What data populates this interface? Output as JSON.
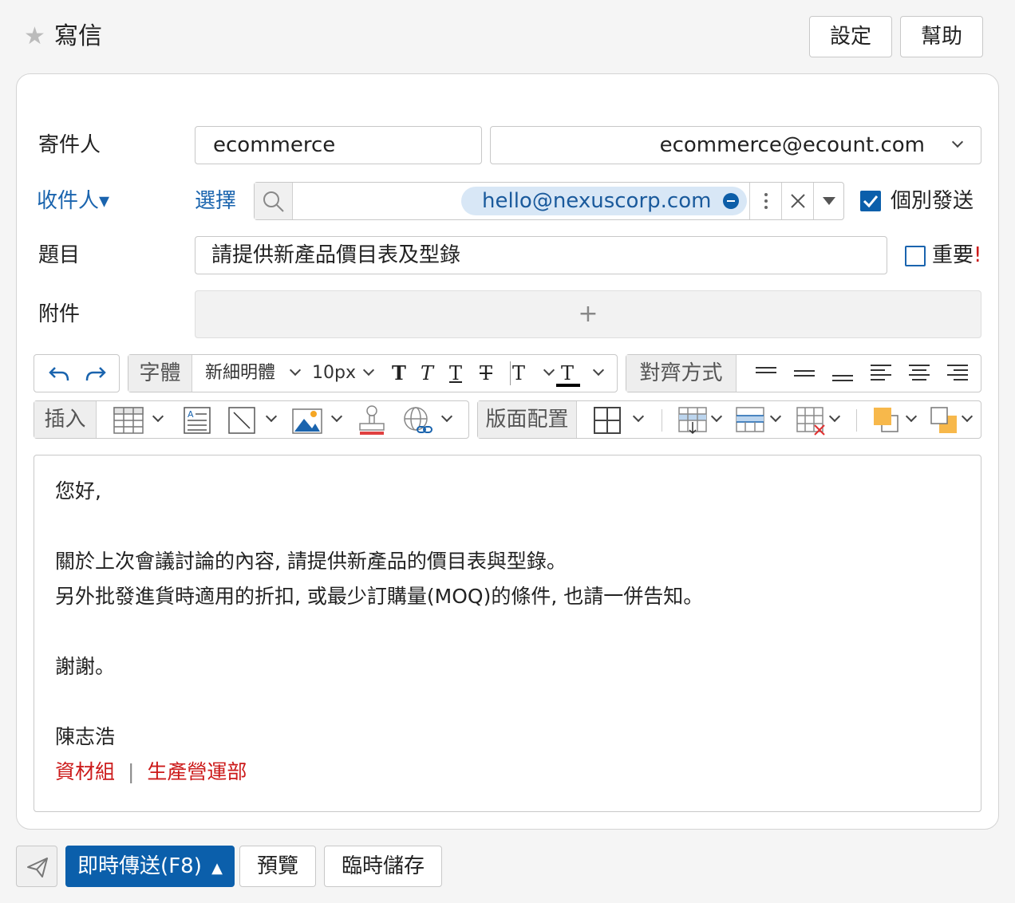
{
  "header": {
    "title": "寫信",
    "settings_label": "設定",
    "help_label": "幫助"
  },
  "form": {
    "sender_label": "寄件人",
    "sender_name": "ecommerce",
    "sender_email": "ecommerce@ecount.com",
    "recipient_label": "收件人",
    "recipient_caret": "▾",
    "select_link": "選擇",
    "recipient_chip": "hello@nexuscorp.com",
    "individual_send_label": "個別發送",
    "individual_send_checked": true,
    "subject_label": "題目",
    "subject_value": "請提供新產品價目表及型錄",
    "important_label": "重要",
    "important_mark": "!",
    "important_checked": false,
    "attachment_label": "附件",
    "attachment_add": "+"
  },
  "toolbar": {
    "font_group_label": "字體",
    "font_family": "新細明體",
    "font_size": "10px",
    "align_group_label": "對齊方式",
    "insert_group_label": "插入",
    "layout_group_label": "版面配置"
  },
  "body": {
    "lines": [
      "您好,",
      "關於上次會議討論的內容, 請提供新產品的價目表與型錄。",
      "另外批發進貨時適用的折扣, 或最少訂購量(MOQ)的條件, 也請一併告知。",
      "謝謝。",
      "陳志浩"
    ],
    "signature_dept": "資材組",
    "signature_separator": "|",
    "signature_division": "生產營運部"
  },
  "footer": {
    "send_label": "即時傳送(F8)",
    "send_caret": "▲",
    "preview_label": "預覽",
    "draft_label": "臨時儲存"
  },
  "colors": {
    "accent": "#0b5fab",
    "link": "#1a64ae",
    "chip_bg": "#d8e7f6",
    "signature_red": "#cc1a1a",
    "star": "#bbbbbb"
  },
  "icons": {
    "star": "star-icon",
    "undo": "undo-icon",
    "redo": "redo-icon",
    "search": "search-icon",
    "more": "more-vertical-icon",
    "clear": "close-icon",
    "dropdown": "caret-down-icon",
    "send": "paper-plane-icon",
    "table": "table-icon",
    "text-box": "text-box-icon",
    "line": "line-icon",
    "image": "image-icon",
    "stamp": "stamp-icon",
    "link": "link-icon"
  }
}
